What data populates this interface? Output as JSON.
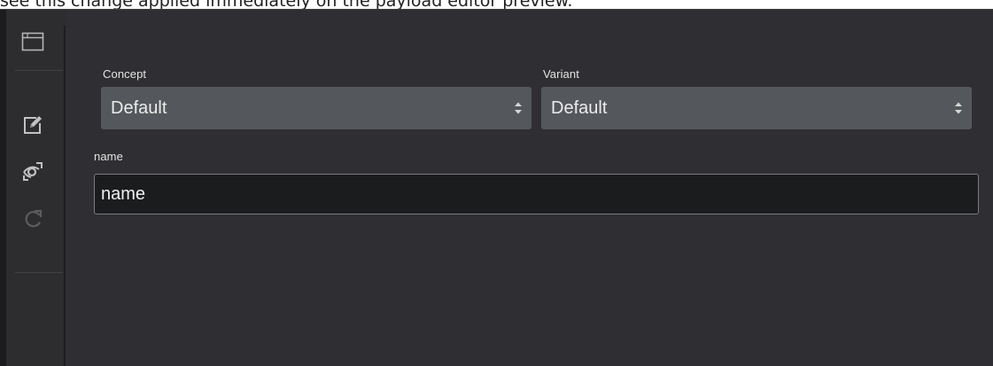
{
  "caption": {
    "text": "see this change applied immediately on the payload editor preview."
  },
  "sidebar": {
    "tools": [
      {
        "icon": "window-icon",
        "label": ""
      },
      {
        "icon": "edit-icon",
        "label": ""
      },
      {
        "icon": "preview-eye-icon",
        "label": ""
      },
      {
        "icon": "refresh-icon",
        "label": ""
      }
    ]
  },
  "form": {
    "concept": {
      "label": "Concept",
      "value": "Default"
    },
    "variant": {
      "label": "Variant",
      "value": "Default"
    },
    "name": {
      "label": "name",
      "value": "name"
    }
  },
  "colors": {
    "panel_bg": "#2f2f33",
    "sidebar_bg": "#2d2d30",
    "select_bg": "#54575b",
    "input_bg": "#1b1c1e",
    "text": "#ececec"
  }
}
